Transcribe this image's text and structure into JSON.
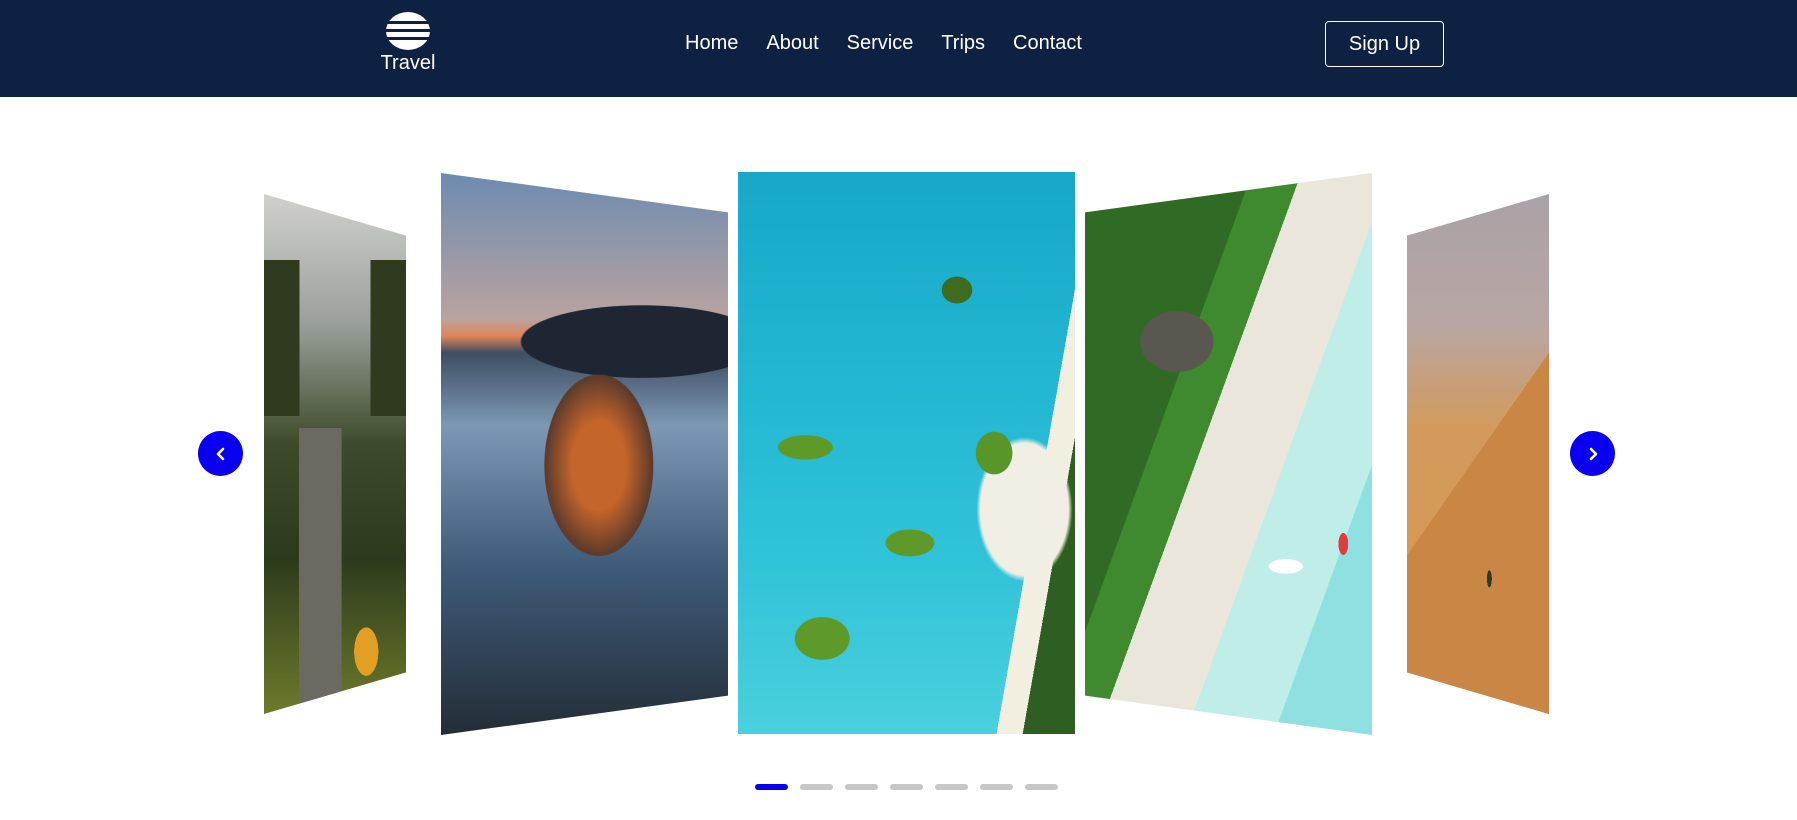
{
  "header": {
    "logo_text": "Travel",
    "nav": [
      {
        "label": "Home"
      },
      {
        "label": "About"
      },
      {
        "label": "Service"
      },
      {
        "label": "Trips"
      },
      {
        "label": "Contact"
      }
    ],
    "signup_label": "Sign Up"
  },
  "carousel": {
    "slides": [
      {
        "name": "gate-road"
      },
      {
        "name": "coastal-village"
      },
      {
        "name": "lagoon-islands"
      },
      {
        "name": "seaplane-beach"
      },
      {
        "name": "desert-dune"
      }
    ],
    "active_slide": 2,
    "dots_count": 7,
    "active_dot": 0,
    "prev_icon": "chevron-left-icon",
    "next_icon": "chevron-right-icon"
  },
  "colors": {
    "header_bg": "#0f2143",
    "accent": "#0a00ee",
    "dot_inactive": "#c7c7c7"
  }
}
